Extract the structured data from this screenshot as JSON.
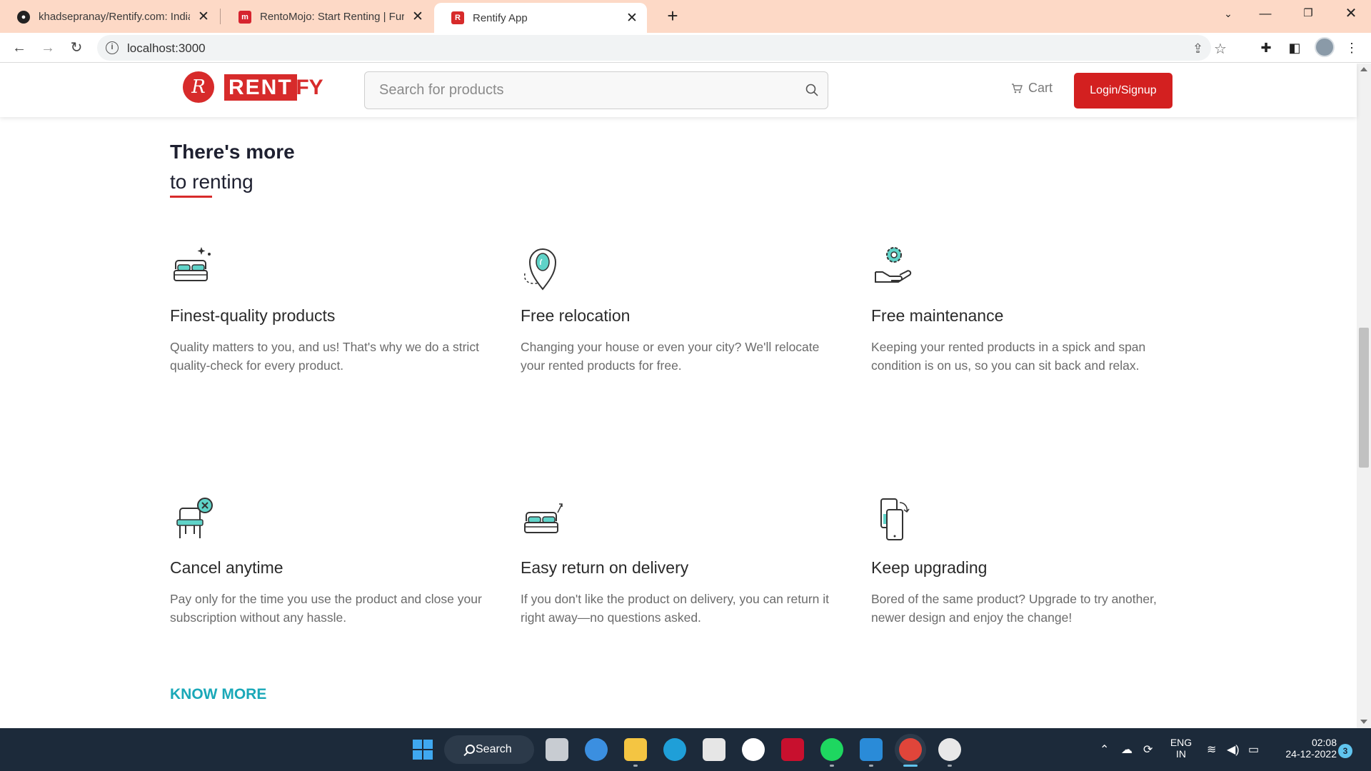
{
  "browser": {
    "tabs": [
      {
        "title": "khadsepranay/Rentify.com: India",
        "icon": "github-icon",
        "active": false
      },
      {
        "title": "RentoMojo: Start Renting | Furnit",
        "icon": "rentomojo-icon",
        "active": false
      },
      {
        "title": "Rentify App",
        "icon": "rentify-icon",
        "active": true
      }
    ],
    "url": "localhost:3000"
  },
  "site": {
    "logo_symbol": "R",
    "logo_rent": "RENT",
    "logo_ify": "IFY",
    "search_placeholder": "Search for products",
    "cart_label": "Cart",
    "login_label": "Login/Signup",
    "brand_color": "#d72b2b",
    "accent_color": "#1aa8b8"
  },
  "section": {
    "title_line1": "There's more",
    "title_line2": "to renting",
    "features": [
      {
        "icon": "bed-sparkle-icon",
        "title": "Finest-quality products",
        "desc": "Quality matters to you, and us! That's why we do a strict quality-check for every product."
      },
      {
        "icon": "location-pin-icon",
        "title": "Free relocation",
        "desc": "Changing your house or even your city? We'll relocate your rented products for free."
      },
      {
        "icon": "gear-hand-icon",
        "title": "Free maintenance",
        "desc": "Keeping your rented products in a spick and span condition is on us, so you can sit back and relax."
      },
      {
        "icon": "chair-cancel-icon",
        "title": "Cancel anytime",
        "desc": "Pay only for the time you use the product and close your subscription without any hassle."
      },
      {
        "icon": "bed-return-icon",
        "title": "Easy return on delivery",
        "desc": "If you don't like the product on delivery, you can return it right away—no questions asked."
      },
      {
        "icon": "phone-upgrade-icon",
        "title": "Keep upgrading",
        "desc": "Bored of the same product? Upgrade to try another, newer design and enjoy the change!"
      }
    ],
    "know_more": "KNOW MORE"
  },
  "taskbar": {
    "search_label": "Search",
    "lang_line1": "ENG",
    "lang_line2": "IN",
    "time": "02:08",
    "date": "24-12-2022",
    "notification_count": "3"
  }
}
